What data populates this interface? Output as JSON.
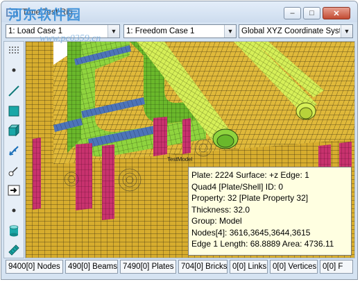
{
  "window": {
    "title": "Time Test Rig",
    "watermark": "河东软件园",
    "watermark_url": "www.pc0359.cn",
    "buttons": {
      "minimize": "–",
      "maximize": "□",
      "close": "✕"
    }
  },
  "toolbar": {
    "load_case": "1: Load Case 1",
    "freedom_case": "1: Freedom Case 1",
    "coordinate_system": "Global XYZ Coordinate System"
  },
  "side_tools": [
    {
      "icon": "node-grid-icon"
    },
    {
      "icon": "node-point-icon"
    },
    {
      "icon": "beam-line-icon"
    },
    {
      "icon": "plate-square-icon"
    },
    {
      "icon": "brick-cube-icon"
    },
    {
      "icon": "link-icon"
    },
    {
      "icon": "vertex-tool-icon"
    },
    {
      "icon": "arrow-right-icon"
    },
    {
      "icon": "small-point-icon"
    },
    {
      "icon": "cylinder-icon"
    },
    {
      "icon": "ruler-icon"
    }
  ],
  "viewport": {
    "cursor_label": "TestModel"
  },
  "tooltip": {
    "lines": [
      "Plate: 2224 Surface: +z Edge: 1",
      "Quad4 [Plate/Shell] ID: 0",
      "Property: 32 [Plate Property 32]",
      "Thickness: 32.0",
      "Group: Model",
      "Nodes[4]: 3616,3645,3644,3615",
      "Edge 1 Length: 68.8889 Area: 4736.11"
    ]
  },
  "statusbar": {
    "nodes": "9400[0] Nodes",
    "beams": "490[0] Beams",
    "plates": "7490[0] Plates",
    "bricks": "704[0] Bricks",
    "links": "0[0] Links",
    "vertices": "0[0] Vertices",
    "extra": "0[0] F"
  },
  "colors": {
    "yellow_mesh": "#e0b93a",
    "green_frame": "#8fd43e",
    "blue_beam": "#4d74b8",
    "magenta_plate": "#c8326e",
    "lime_beam": "#d6ef58",
    "tooltip_bg": "#ffffe1"
  }
}
